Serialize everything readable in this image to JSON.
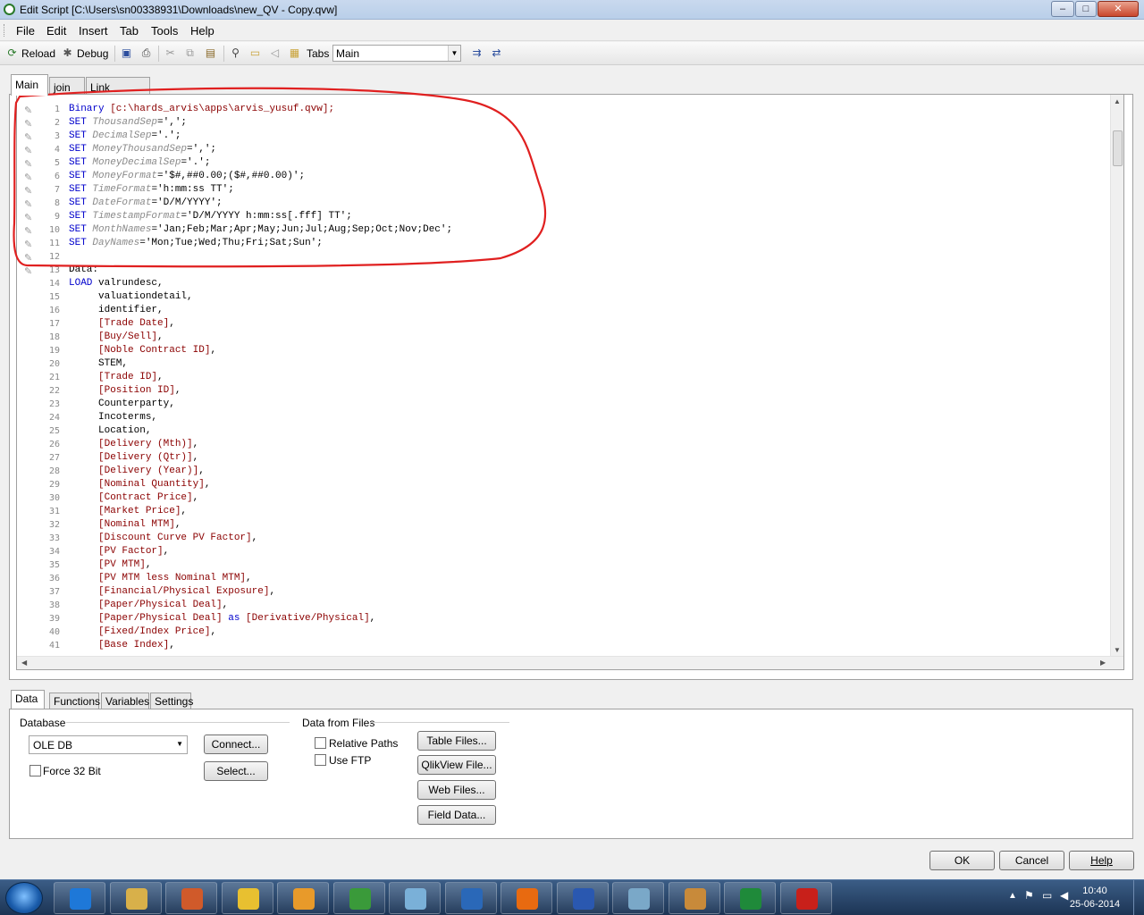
{
  "window": {
    "title": "Edit Script [C:\\Users\\sn00338931\\Downloads\\new_QV - Copy.qvw]",
    "minimize": "–",
    "maximize": "□",
    "close": "✕"
  },
  "menu": [
    "File",
    "Edit",
    "Insert",
    "Tab",
    "Tools",
    "Help"
  ],
  "toolbar": {
    "reload": "Reload",
    "debug": "Debug",
    "tabs_label": "Tabs",
    "tabs_value": "Main"
  },
  "script_tabs": [
    "Main",
    "join",
    "Link Creation"
  ],
  "script_lines": [
    [
      {
        "t": "Binary",
        "c": "kw"
      },
      {
        "t": " [c:\\hards_arvis\\apps\\arvis_yusuf.qvw];",
        "c": "fld"
      }
    ],
    [
      {
        "t": "SET",
        "c": "kw"
      },
      {
        "t": " ThousandSep",
        "c": "var"
      },
      {
        "t": "=',';",
        "c": "str"
      }
    ],
    [
      {
        "t": "SET",
        "c": "kw"
      },
      {
        "t": " DecimalSep",
        "c": "var"
      },
      {
        "t": "='.';",
        "c": "str"
      }
    ],
    [
      {
        "t": "SET",
        "c": "kw"
      },
      {
        "t": " MoneyThousandSep",
        "c": "var"
      },
      {
        "t": "=',';",
        "c": "str"
      }
    ],
    [
      {
        "t": "SET",
        "c": "kw"
      },
      {
        "t": " MoneyDecimalSep",
        "c": "var"
      },
      {
        "t": "='.';",
        "c": "str"
      }
    ],
    [
      {
        "t": "SET",
        "c": "kw"
      },
      {
        "t": " MoneyFormat",
        "c": "var"
      },
      {
        "t": "='$#,##0.00;($#,##0.00)';",
        "c": "str"
      }
    ],
    [
      {
        "t": "SET",
        "c": "kw"
      },
      {
        "t": " TimeFormat",
        "c": "var"
      },
      {
        "t": "='h:mm:ss TT';",
        "c": "str"
      }
    ],
    [
      {
        "t": "SET",
        "c": "kw"
      },
      {
        "t": " DateFormat",
        "c": "var"
      },
      {
        "t": "='D/M/YYYY';",
        "c": "str"
      }
    ],
    [
      {
        "t": "SET",
        "c": "kw"
      },
      {
        "t": " TimestampFormat",
        "c": "var"
      },
      {
        "t": "='D/M/YYYY h:mm:ss[.fff] TT';",
        "c": "str"
      }
    ],
    [
      {
        "t": "SET",
        "c": "kw"
      },
      {
        "t": " MonthNames",
        "c": "var"
      },
      {
        "t": "='Jan;Feb;Mar;Apr;May;Jun;Jul;Aug;Sep;Oct;Nov;Dec';",
        "c": "str"
      }
    ],
    [
      {
        "t": "SET",
        "c": "kw"
      },
      {
        "t": " DayNames",
        "c": "var"
      },
      {
        "t": "='Mon;Tue;Wed;Thu;Fri;Sat;Sun';",
        "c": "str"
      }
    ],
    [],
    [
      {
        "t": "Data:",
        "c": "plain"
      }
    ],
    [
      {
        "t": "LOAD",
        "c": "kw"
      },
      {
        "t": " valrundesc,",
        "c": "plain"
      }
    ],
    [
      {
        "t": "     valuationdetail,",
        "c": "plain"
      }
    ],
    [
      {
        "t": "     identifier,",
        "c": "plain"
      }
    ],
    [
      {
        "t": "     [Trade Date]",
        "c": "fld"
      },
      {
        "t": ",",
        "c": "plain"
      }
    ],
    [
      {
        "t": "     [Buy/Sell]",
        "c": "fld"
      },
      {
        "t": ",",
        "c": "plain"
      }
    ],
    [
      {
        "t": "     [Noble Contract ID]",
        "c": "fld"
      },
      {
        "t": ",",
        "c": "plain"
      }
    ],
    [
      {
        "t": "     STEM,",
        "c": "plain"
      }
    ],
    [
      {
        "t": "     [Trade ID]",
        "c": "fld"
      },
      {
        "t": ",",
        "c": "plain"
      }
    ],
    [
      {
        "t": "     [Position ID]",
        "c": "fld"
      },
      {
        "t": ",",
        "c": "plain"
      }
    ],
    [
      {
        "t": "     Counterparty,",
        "c": "plain"
      }
    ],
    [
      {
        "t": "     Incoterms,",
        "c": "plain"
      }
    ],
    [
      {
        "t": "     Location,",
        "c": "plain"
      }
    ],
    [
      {
        "t": "     [Delivery (Mth)]",
        "c": "fld"
      },
      {
        "t": ",",
        "c": "plain"
      }
    ],
    [
      {
        "t": "     [Delivery (Qtr)]",
        "c": "fld"
      },
      {
        "t": ",",
        "c": "plain"
      }
    ],
    [
      {
        "t": "     [Delivery (Year)]",
        "c": "fld"
      },
      {
        "t": ",",
        "c": "plain"
      }
    ],
    [
      {
        "t": "     [Nominal Quantity]",
        "c": "fld"
      },
      {
        "t": ",",
        "c": "plain"
      }
    ],
    [
      {
        "t": "     [Contract Price]",
        "c": "fld"
      },
      {
        "t": ",",
        "c": "plain"
      }
    ],
    [
      {
        "t": "     [Market Price]",
        "c": "fld"
      },
      {
        "t": ",",
        "c": "plain"
      }
    ],
    [
      {
        "t": "     [Nominal MTM]",
        "c": "fld"
      },
      {
        "t": ",",
        "c": "plain"
      }
    ],
    [
      {
        "t": "     [Discount Curve PV Factor]",
        "c": "fld"
      },
      {
        "t": ",",
        "c": "plain"
      }
    ],
    [
      {
        "t": "     [PV Factor]",
        "c": "fld"
      },
      {
        "t": ",",
        "c": "plain"
      }
    ],
    [
      {
        "t": "     [PV MTM]",
        "c": "fld"
      },
      {
        "t": ",",
        "c": "plain"
      }
    ],
    [
      {
        "t": "     [PV MTM less Nominal MTM]",
        "c": "fld"
      },
      {
        "t": ",",
        "c": "plain"
      }
    ],
    [
      {
        "t": "     [Financial/Physical Exposure]",
        "c": "fld"
      },
      {
        "t": ",",
        "c": "plain"
      }
    ],
    [
      {
        "t": "     [Paper/Physical Deal]",
        "c": "fld"
      },
      {
        "t": ",",
        "c": "plain"
      }
    ],
    [
      {
        "t": "     [Paper/Physical Deal]",
        "c": "fld"
      },
      {
        "t": " as ",
        "c": "kw"
      },
      {
        "t": "[Derivative/Physical]",
        "c": "fld"
      },
      {
        "t": ",",
        "c": "plain"
      }
    ],
    [
      {
        "t": "     [Fixed/Index Price]",
        "c": "fld"
      },
      {
        "t": ",",
        "c": "plain"
      }
    ],
    [
      {
        "t": "     [Base Index]",
        "c": "fld"
      },
      {
        "t": ",",
        "c": "plain"
      }
    ]
  ],
  "bottom_tabs": [
    "Data",
    "Functions",
    "Variables",
    "Settings"
  ],
  "data_panel": {
    "database_label": "Database",
    "database_value": "OLE DB",
    "connect": "Connect...",
    "select": "Select...",
    "force32": "Force 32 Bit",
    "files_label": "Data from Files",
    "relative_paths": "Relative Paths",
    "use_ftp": "Use FTP",
    "table_files": "Table Files...",
    "qlikview_file": "QlikView File...",
    "web_files": "Web Files...",
    "field_data": "Field Data..."
  },
  "dialog_buttons": {
    "ok": "OK",
    "cancel": "Cancel",
    "help": "Help"
  },
  "taskbar": {
    "apps": [
      "internet-explorer",
      "file-explorer",
      "media-player",
      "chrome",
      "outlook",
      "qlikview",
      "windows-explorer",
      "remote-desktop",
      "firefox",
      "word",
      "notepad",
      "tools",
      "excel",
      "acrobat"
    ],
    "time": "10:40",
    "date": "25-06-2014"
  },
  "colors": {
    "keyword": "#0000cc",
    "variable": "#8a8a8a",
    "field": "#8b0000",
    "annotation": "#e02020"
  }
}
